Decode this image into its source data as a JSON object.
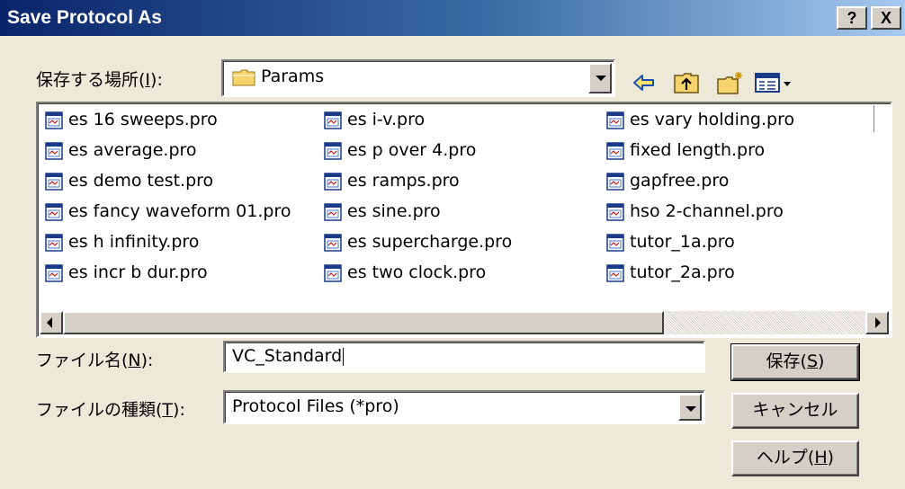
{
  "window": {
    "title": "Save Protocol As",
    "help_button": "?",
    "close_button": "X"
  },
  "location": {
    "label": "保存する場所(I):",
    "label_prefix": "保存する場所(",
    "label_mnemonic": "I",
    "label_suffix": "):",
    "value": "Params"
  },
  "toolbar": {
    "icons": [
      "back-arrow-icon",
      "up-folder-icon",
      "new-folder-icon",
      "view-menu-icon"
    ]
  },
  "files": {
    "columns": [
      [
        "es 16 sweeps.pro",
        "es average.pro",
        "es demo test.pro",
        "es fancy waveform 01.pro",
        "es h infinity.pro",
        "es incr b dur.pro"
      ],
      [
        "es i-v.pro",
        "es p over 4.pro",
        "es ramps.pro",
        "es sine.pro",
        "es supercharge.pro",
        "es two clock.pro"
      ],
      [
        "es vary holding.pro",
        "fixed length.pro",
        "gapfree.pro",
        "hso 2-channel.pro",
        "tutor_1a.pro",
        "tutor_2a.pro"
      ]
    ]
  },
  "filename": {
    "label_prefix": "ファイル名(",
    "label_mnemonic": "N",
    "label_suffix": "):",
    "value": "VC_Standard"
  },
  "filetype": {
    "label_prefix": "ファイルの種類(",
    "label_mnemonic": "T",
    "label_suffix": "):",
    "value": "Protocol Files (*pro)"
  },
  "buttons": {
    "save_prefix": "保存(",
    "save_mnemonic": "S",
    "save_suffix": ")",
    "cancel": "キャンセル",
    "help_prefix": "ヘルプ(",
    "help_mnemonic": "H",
    "help_suffix": ")"
  },
  "colors": {
    "titlebar_start": "#0a246a",
    "titlebar_end": "#a6caf0",
    "face": "#ece9d8"
  }
}
